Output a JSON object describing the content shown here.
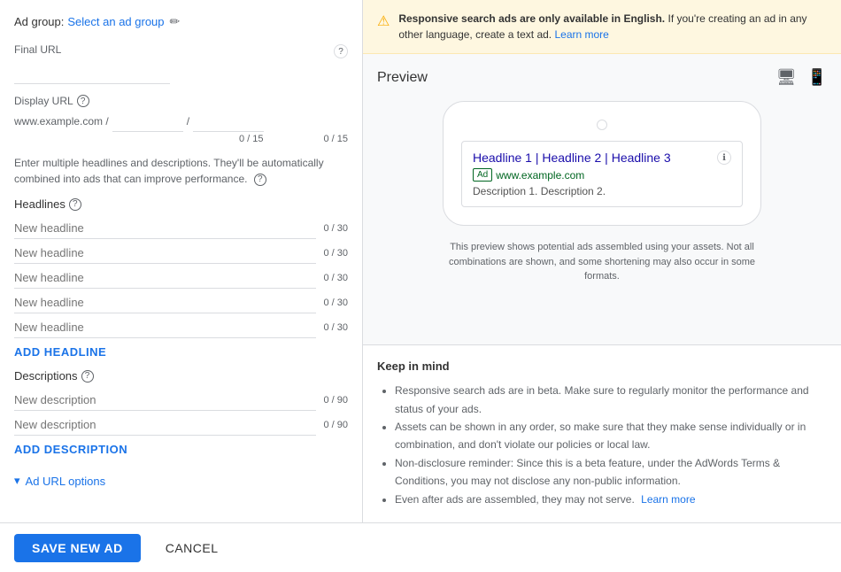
{
  "adGroup": {
    "label": "Ad group:",
    "selectText": "Select an ad group",
    "editIconLabel": "✏"
  },
  "finalUrl": {
    "label": "Final URL",
    "placeholder": "",
    "infoIcon": "?"
  },
  "displayUrl": {
    "label": "Display URL",
    "helpIcon": "?",
    "staticText": "www.example.com /",
    "staticText2": "/"
  },
  "counters": {
    "headline1": "0 / 15",
    "headline2": "0 / 15"
  },
  "hintText": "Enter multiple headlines and descriptions. They'll be automatically combined into ads that can improve performance.",
  "headlines": {
    "sectionLabel": "Headlines",
    "fields": [
      {
        "placeholder": "New headline",
        "count": "0 / 30"
      },
      {
        "placeholder": "New headline",
        "count": "0 / 30"
      },
      {
        "placeholder": "New headline",
        "count": "0 / 30"
      },
      {
        "placeholder": "New headline",
        "count": "0 / 30"
      },
      {
        "placeholder": "New headline",
        "count": "0 / 30"
      }
    ],
    "addLabel": "ADD HEADLINE"
  },
  "descriptions": {
    "sectionLabel": "Descriptions",
    "fields": [
      {
        "placeholder": "New description",
        "count": "0 / 90"
      },
      {
        "placeholder": "New description",
        "count": "0 / 90"
      }
    ],
    "addLabel": "ADD DESCRIPTION"
  },
  "adUrlOptions": {
    "label": "Ad URL options"
  },
  "warning": {
    "text": "Responsive search ads are only available in English.",
    "subText": " If you're creating an ad in any other language, create a text ad. ",
    "linkText": "Learn more"
  },
  "preview": {
    "title": "Preview",
    "headline": "Headline 1 | Headline 2 | Headline 3",
    "adBadge": "Ad",
    "url": "www.example.com",
    "description": "Description 1. Description 2.",
    "note": "This preview shows potential ads assembled using your assets. Not all combinations are shown, and some shortening may also occur in some formats."
  },
  "keepInMind": {
    "title": "Keep in mind",
    "items": [
      "Responsive search ads are in beta. Make sure to regularly monitor the performance and status of your ads.",
      "Assets can be shown in any order, so make sure that they make sense individually or in combination, and don't violate our policies or local law.",
      "Non-disclosure reminder: Since this is a beta feature, under the AdWords Terms & Conditions, you may not disclose any non-public information.",
      "Even after ads are assembled, they may not serve."
    ],
    "lastItemLink": "Learn more"
  },
  "footer": {
    "saveLabel": "SAVE NEW AD",
    "cancelLabel": "CANCEL"
  }
}
